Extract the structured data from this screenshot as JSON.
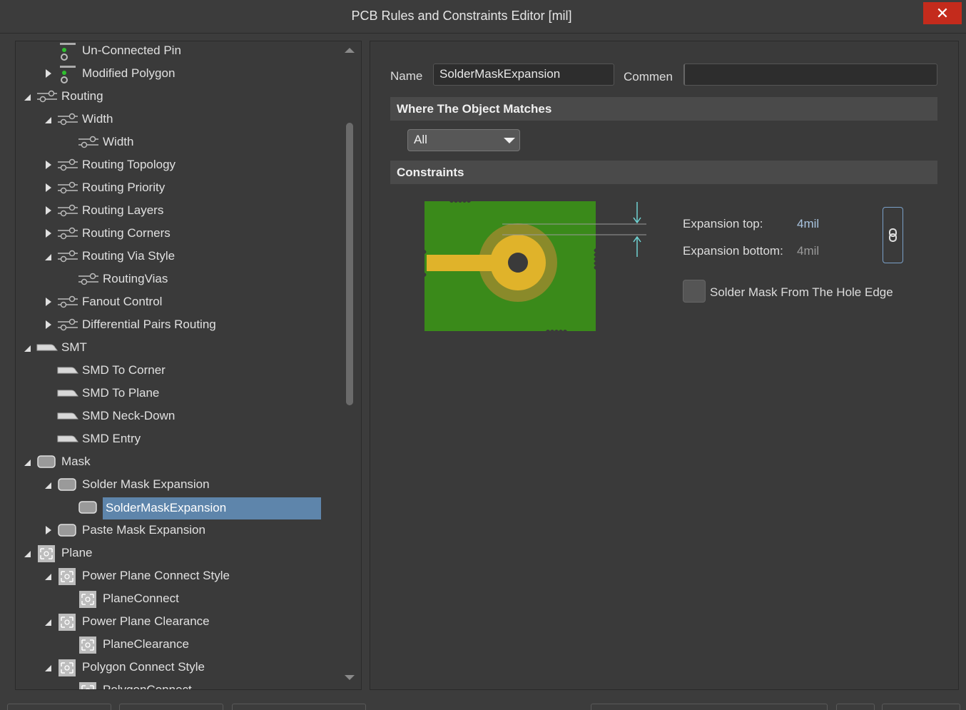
{
  "window": {
    "title": "PCB Rules and Constraints Editor [mil]",
    "close_glyph": "✕"
  },
  "tree": [
    {
      "label": "Un-Connected Pin",
      "level": 2,
      "arrow": "none",
      "icon": "unconnected-pin-icon"
    },
    {
      "label": "Modified Polygon",
      "level": 2,
      "arrow": "collapsed",
      "icon": "modified-polygon-icon"
    },
    {
      "label": "Routing",
      "level": 1,
      "arrow": "expanded",
      "icon": "routing-icon"
    },
    {
      "label": "Width",
      "level": 2,
      "arrow": "expanded",
      "icon": "routing-icon"
    },
    {
      "label": "Width",
      "level": 3,
      "arrow": "none",
      "icon": "routing-icon"
    },
    {
      "label": "Routing Topology",
      "level": 2,
      "arrow": "collapsed",
      "icon": "routing-icon"
    },
    {
      "label": "Routing Priority",
      "level": 2,
      "arrow": "collapsed",
      "icon": "routing-icon"
    },
    {
      "label": "Routing Layers",
      "level": 2,
      "arrow": "collapsed",
      "icon": "routing-icon"
    },
    {
      "label": "Routing Corners",
      "level": 2,
      "arrow": "collapsed",
      "icon": "routing-icon"
    },
    {
      "label": "Routing Via Style",
      "level": 2,
      "arrow": "expanded",
      "icon": "routing-icon"
    },
    {
      "label": "RoutingVias",
      "level": 3,
      "arrow": "none",
      "icon": "routing-icon"
    },
    {
      "label": "Fanout Control",
      "level": 2,
      "arrow": "collapsed",
      "icon": "routing-icon"
    },
    {
      "label": "Differential Pairs Routing",
      "level": 2,
      "arrow": "collapsed",
      "icon": "routing-icon"
    },
    {
      "label": "SMT",
      "level": 1,
      "arrow": "expanded",
      "icon": "smt-icon"
    },
    {
      "label": "SMD To Corner",
      "level": 2,
      "arrow": "none",
      "icon": "smt-icon"
    },
    {
      "label": "SMD To Plane",
      "level": 2,
      "arrow": "none",
      "icon": "smt-icon"
    },
    {
      "label": "SMD Neck-Down",
      "level": 2,
      "arrow": "none",
      "icon": "smt-icon"
    },
    {
      "label": "SMD Entry",
      "level": 2,
      "arrow": "none",
      "icon": "smt-icon"
    },
    {
      "label": "Mask",
      "level": 1,
      "arrow": "expanded",
      "icon": "mask-icon"
    },
    {
      "label": "Solder Mask Expansion",
      "level": 2,
      "arrow": "expanded",
      "icon": "mask-icon"
    },
    {
      "label": "SolderMaskExpansion",
      "level": 3,
      "arrow": "none",
      "icon": "mask-icon",
      "selected": true
    },
    {
      "label": "Paste Mask Expansion",
      "level": 2,
      "arrow": "collapsed",
      "icon": "mask-icon"
    },
    {
      "label": "Plane",
      "level": 1,
      "arrow": "expanded",
      "icon": "plane-icon"
    },
    {
      "label": "Power Plane Connect Style",
      "level": 2,
      "arrow": "expanded",
      "icon": "plane-icon"
    },
    {
      "label": "PlaneConnect",
      "level": 3,
      "arrow": "none",
      "icon": "plane-icon"
    },
    {
      "label": "Power Plane Clearance",
      "level": 2,
      "arrow": "expanded",
      "icon": "plane-icon"
    },
    {
      "label": "PlaneClearance",
      "level": 3,
      "arrow": "none",
      "icon": "plane-icon"
    },
    {
      "label": "Polygon Connect Style",
      "level": 2,
      "arrow": "expanded",
      "icon": "plane-icon"
    },
    {
      "label": "PolygonConnect",
      "level": 3,
      "arrow": "none",
      "icon": "plane-icon"
    }
  ],
  "rule": {
    "name_label": "Name",
    "name_value": "SolderMaskExpansion",
    "comment_label": "Commen",
    "comment_value": "",
    "where_header": "Where The Object Matches",
    "match_value": "All",
    "constraints_header": "Constraints",
    "expansion_top_label": "Expansion top:",
    "expansion_top_value": "4mil",
    "expansion_bottom_label": "Expansion bottom:",
    "expansion_bottom_value": "4mil",
    "hole_edge_label": "Solder Mask From The Hole Edge",
    "hole_edge_checked": false
  },
  "colors": {
    "board": "#3a8a1a",
    "pad": "#e0b32a",
    "mask_ring": "#8a8a2a",
    "selection": "#5e85ab",
    "accent": "#7aa0c8"
  }
}
